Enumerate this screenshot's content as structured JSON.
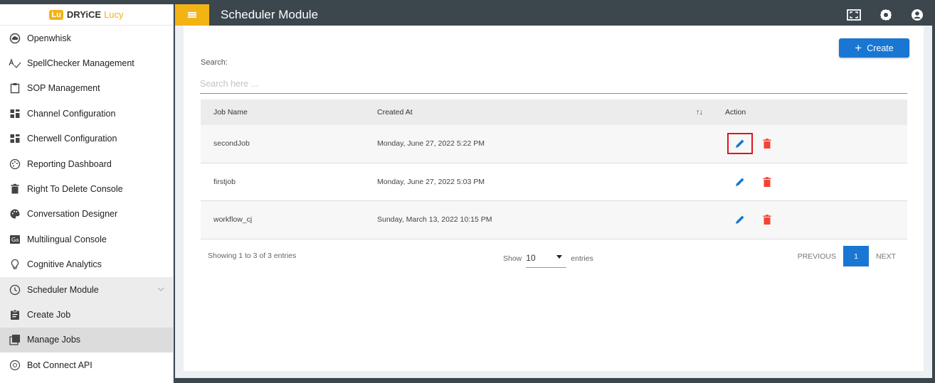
{
  "logo": {
    "badge": "Lu",
    "brand": "DRYiCE",
    "product": "Lucy"
  },
  "sidebar": {
    "items": [
      {
        "label": "Openwhisk",
        "icon": "cloud-icon"
      },
      {
        "label": "SpellChecker Management",
        "icon": "spellcheck-icon"
      },
      {
        "label": "SOP Management",
        "icon": "clipboard-icon"
      },
      {
        "label": "Channel Configuration",
        "icon": "dashboard-icon"
      },
      {
        "label": "Cherwell Configuration",
        "icon": "dashboard-icon"
      },
      {
        "label": "Reporting Dashboard",
        "icon": "palette-icon"
      },
      {
        "label": "Right To Delete Console",
        "icon": "trash-icon"
      },
      {
        "label": "Conversation Designer",
        "icon": "palette-icon"
      },
      {
        "label": "Multilingual Console",
        "icon": "translate-icon"
      },
      {
        "label": "Cognitive Analytics",
        "icon": "lightbulb-icon"
      },
      {
        "label": "Scheduler Module",
        "icon": "clock-icon"
      },
      {
        "label": "Create Job",
        "icon": "assignment-icon"
      },
      {
        "label": "Manage Jobs",
        "icon": "library-icon"
      },
      {
        "label": "Bot Connect API",
        "icon": "api-icon"
      }
    ]
  },
  "header": {
    "title": "Scheduler Module",
    "icons": [
      "fullscreen-icon",
      "settings-icon",
      "account-icon"
    ]
  },
  "main": {
    "create_label": "Create",
    "search_label": "Search:",
    "search_placeholder": "Search here ...",
    "columns": {
      "name": "Job Name",
      "created": "Created At",
      "action": "Action"
    },
    "rows": [
      {
        "name": "secondJob",
        "created": "Monday, June 27, 2022 5:22 PM"
      },
      {
        "name": "firstjob",
        "created": "Monday, June 27, 2022 5:03 PM"
      },
      {
        "name": "workflow_cj",
        "created": "Sunday, March 13, 2022 10:15 PM"
      }
    ],
    "showing": "Showing 1 to 3 of 3 entries",
    "show_label": "Show",
    "show_value": "10",
    "entries_label": "entries",
    "prev_label": "PREVIOUS",
    "page": "1",
    "next_label": "NEXT"
  },
  "colors": {
    "accent": "#1976d2",
    "brand": "#f2b315",
    "header": "#3b464d",
    "delete": "#f44336",
    "highlight": "#e0141e"
  }
}
